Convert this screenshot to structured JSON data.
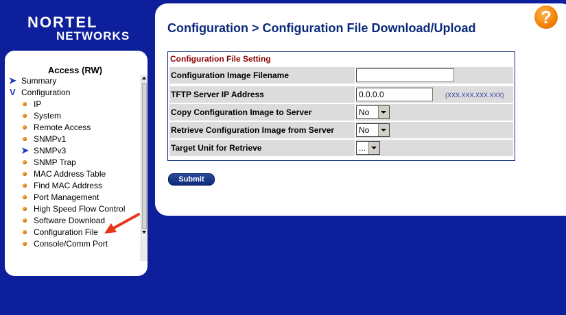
{
  "logo": {
    "line1": "NORTEL",
    "line2": "NETWORKS"
  },
  "nav": {
    "title": "Access (RW)",
    "items": [
      {
        "label": "Summary",
        "icon": "chevron-right-icon"
      },
      {
        "label": "Configuration",
        "icon": "chevron-down-icon"
      },
      {
        "label": "IP",
        "icon": "bullet-icon"
      },
      {
        "label": "System",
        "icon": "bullet-icon"
      },
      {
        "label": "Remote Access",
        "icon": "bullet-icon"
      },
      {
        "label": "SNMPv1",
        "icon": "bullet-icon"
      },
      {
        "label": "SNMPv3",
        "icon": "chevron-right-icon"
      },
      {
        "label": "SNMP Trap",
        "icon": "bullet-icon"
      },
      {
        "label": "MAC Address Table",
        "icon": "bullet-icon"
      },
      {
        "label": "Find MAC Address",
        "icon": "bullet-icon"
      },
      {
        "label": "Port Management",
        "icon": "bullet-icon"
      },
      {
        "label": "High Speed Flow Control",
        "icon": "bullet-icon"
      },
      {
        "label": "Software Download",
        "icon": "bullet-icon"
      },
      {
        "label": "Configuration File",
        "icon": "bullet-icon"
      },
      {
        "label": "Console/Comm Port",
        "icon": "bullet-icon"
      }
    ]
  },
  "page": {
    "title": "Configuration > Configuration File Download/Upload",
    "help_icon": "?"
  },
  "form": {
    "section_title": "Configuration File Setting",
    "rows": [
      {
        "label": "Configuration Image Filename",
        "value": ""
      },
      {
        "label": "TFTP Server IP Address",
        "value": "0.0.0.0",
        "hint": "(XXX.XXX.XXX.XXX)"
      },
      {
        "label": "Copy Configuration Image to Server",
        "value": "No"
      },
      {
        "label": "Retrieve Configuration Image from Server",
        "value": "No"
      },
      {
        "label": "Target Unit for Retrieve",
        "value": "..."
      }
    ],
    "submit_label": "Submit"
  },
  "colors": {
    "background": "#0d1f9a",
    "title": "#0b2a7a",
    "section_title": "#8a0000",
    "help": "#f07d00",
    "arrow": "#e8361a"
  }
}
